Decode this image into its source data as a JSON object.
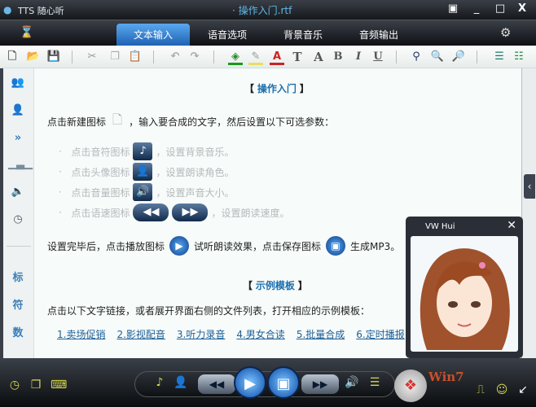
{
  "window": {
    "app_title": "TTS 随心听",
    "document_title": "· 操作入门.rtf",
    "buttons": [
      "▣",
      "_",
      "□",
      "X"
    ]
  },
  "tabs": [
    {
      "label": "文本输入",
      "active": true
    },
    {
      "label": "语音选项"
    },
    {
      "label": "背景音乐"
    },
    {
      "label": "音频输出"
    }
  ],
  "toolbar": [
    "new",
    "open",
    "save",
    "cut",
    "copy",
    "paste",
    "undo",
    "redo",
    "fill-color",
    "highlight",
    "font-color",
    "T",
    "A",
    "B",
    "I",
    "U",
    "find",
    "zoom-in",
    "zoom-out",
    "list1",
    "list2"
  ],
  "toolbar_text": {
    "t": "T",
    "a": "A",
    "b": "B",
    "i": "I",
    "u": "U"
  },
  "sidebar": {
    "labels": [
      "标",
      "符",
      "数"
    ]
  },
  "content": {
    "section1_title": "操作入门",
    "bracket_open": "【",
    "bracket_close": "】",
    "intro_a": "点击新建图标",
    "intro_b": "，输入要合成的文字，然后设置以下可选参数：",
    "bullets": [
      {
        "a": "点击音符图标",
        "b": "，设置背景音乐。"
      },
      {
        "a": "点击头像图标",
        "b": "，设置朗读角色。"
      },
      {
        "a": "点击音量图标",
        "b": "，设置声音大小。"
      },
      {
        "a": "点击语速图标",
        "b": "，设置朗读速度。"
      }
    ],
    "final_a": "设置完毕后，点击播放图标",
    "final_b": "试听朗读效果，点击保存图标",
    "final_c": "生成MP3。",
    "section2_title": "示例模板",
    "templates_intro": "点击以下文字链接，或者展开界面右侧的文件列表，打开相应的示例模板：",
    "links": [
      "1.卖场促销",
      "2.影视配音",
      "3.听力录音",
      "4.男女合读",
      "5.批量合成",
      "6.定时播报"
    ]
  },
  "avatar": {
    "name": "VW Hui",
    "close": "✕"
  },
  "bottom": {
    "logo_text": "Win7"
  }
}
